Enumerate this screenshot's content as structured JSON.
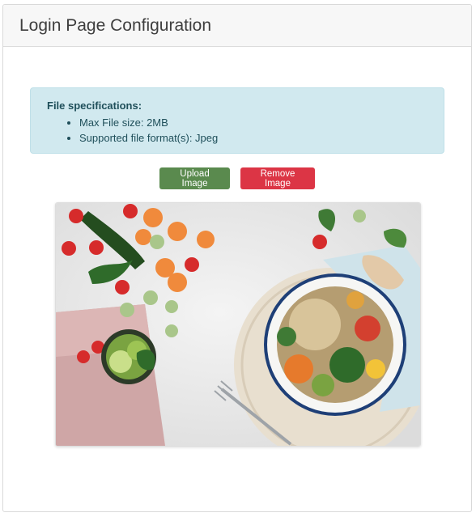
{
  "header": {
    "title": "Login Page Configuration"
  },
  "info": {
    "title": "File specifications:",
    "items": [
      "Max File size: 2MB",
      "Supported file format(s): Jpeg"
    ]
  },
  "actions": {
    "upload_label": "Upload Image",
    "remove_label": "Remove Image"
  },
  "colors": {
    "upload": "#5a8a4e",
    "remove": "#dc3545",
    "info_bg": "#d1e9ef"
  },
  "image": {
    "subject": "food-photo",
    "alt": ""
  }
}
